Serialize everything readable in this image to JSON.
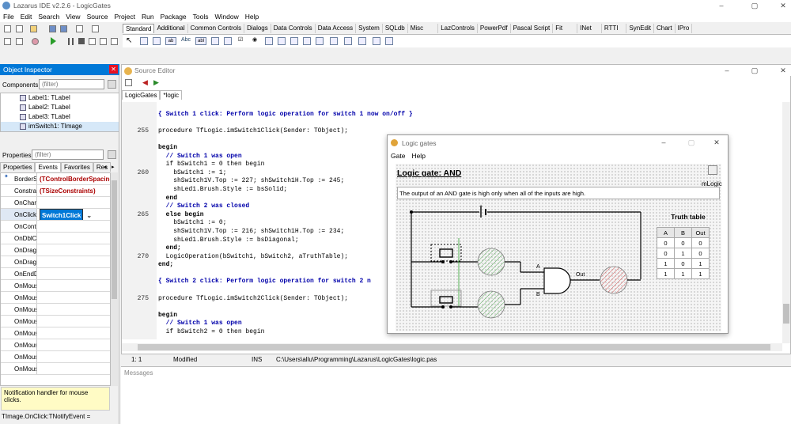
{
  "app": {
    "title": "Lazarus IDE v2.2.6 - LogicGates",
    "menu": [
      "File",
      "Edit",
      "Search",
      "View",
      "Source",
      "Project",
      "Run",
      "Package",
      "Tools",
      "Window",
      "Help"
    ],
    "window_buttons": [
      "–",
      "▢",
      "✕"
    ]
  },
  "palette": {
    "tabs": [
      "Standard",
      "Additional",
      "Common Controls",
      "Dialogs",
      "Data Controls",
      "Data Access",
      "System",
      "SQLdb",
      "Misc",
      "LazControls",
      "PowerPdf",
      "Pascal Script",
      "Fit",
      "INet",
      "RTTI",
      "SynEdit",
      "Chart",
      "IPro"
    ],
    "selected": "Standard",
    "glyphs": [
      "ab",
      "Abc",
      "abl",
      "⎘",
      "OK",
      "☑",
      "◉"
    ]
  },
  "object_inspector": {
    "title": "Object Inspector",
    "components_label": "Components",
    "filter_placeholder": "(filter)",
    "tree": [
      {
        "label": "Label1: TLabel",
        "selected": false
      },
      {
        "label": "Label2: TLabel",
        "selected": false
      },
      {
        "label": "Label3: TLabel",
        "selected": false
      },
      {
        "label": "imSwitch1: TImage",
        "selected": true
      }
    ],
    "properties_label": "Properties",
    "prop_filter_placeholder": "(filter)",
    "tabs": [
      "Properties",
      "Events",
      "Favorites",
      "Res"
    ],
    "selected_tab": "Events",
    "events": [
      {
        "name": "BorderSpacing",
        "value": "(TControlBorderSpacing)",
        "marker": "",
        "selected": false
      },
      {
        "name": "Constraints",
        "value": "(TSizeConstraints)",
        "marker": "",
        "selected": false
      },
      {
        "name": "OnChangeBounds",
        "value": "",
        "marker": "",
        "selected": false
      },
      {
        "name": "OnClick",
        "value": "Switch1Click",
        "marker": "✦",
        "selected": true
      },
      {
        "name": "OnContextPopup",
        "value": "",
        "marker": "",
        "selected": false
      },
      {
        "name": "OnDblClick",
        "value": "",
        "marker": "",
        "selected": false
      },
      {
        "name": "OnDragDrop",
        "value": "",
        "marker": "",
        "selected": false
      },
      {
        "name": "OnDragOver",
        "value": "",
        "marker": "",
        "selected": false
      },
      {
        "name": "OnEndDrag",
        "value": "",
        "marker": "",
        "selected": false
      },
      {
        "name": "OnMouseDown",
        "value": "",
        "marker": "",
        "selected": false
      },
      {
        "name": "OnMouseEnter",
        "value": "",
        "marker": "",
        "selected": false
      },
      {
        "name": "OnMouseLeave",
        "value": "",
        "marker": "",
        "selected": false
      },
      {
        "name": "OnMouseMove",
        "value": "",
        "marker": "",
        "selected": false
      },
      {
        "name": "OnMouseUp",
        "value": "",
        "marker": "",
        "selected": false
      },
      {
        "name": "OnMouseWheel",
        "value": "",
        "marker": "",
        "selected": false
      },
      {
        "name": "OnMouseWheelDown",
        "value": "",
        "marker": "",
        "selected": false
      },
      {
        "name": "OnMouseWheelUp",
        "value": "",
        "marker": "",
        "selected": false
      }
    ],
    "notification": "Notification handler for mouse clicks.",
    "status": "TImage.OnClick:TNotifyEvent ="
  },
  "source_editor": {
    "title": "Source Editor",
    "tabs": [
      "LogicGates",
      "*logic"
    ],
    "selected_tab": "*logic",
    "lines": [
      {
        "n": "",
        "t": "",
        "c": ""
      },
      {
        "n": "",
        "t": "{ Switch 1 click: Perform logic operation for switch 1 now on/off }",
        "c": "cm"
      },
      {
        "n": "",
        "t": "",
        "c": ""
      },
      {
        "n": "255",
        "t": "procedure TfLogic.imSwitch1Click(Sender: TObject);",
        "c": "kw1"
      },
      {
        "n": "",
        "t": "",
        "c": ""
      },
      {
        "n": "",
        "t": "begin",
        "c": "kw"
      },
      {
        "n": "",
        "t": "  // Switch 1 was open",
        "c": "cm"
      },
      {
        "n": "",
        "t": "  if bSwitch1 = 0 then begin",
        "c": "kw2"
      },
      {
        "n": "260",
        "t": "    bSwitch1 := 1;",
        "c": ""
      },
      {
        "n": "",
        "t": "    shSwitch1V.Top := 227; shSwitch1H.Top := 245;",
        "c": ""
      },
      {
        "n": "",
        "t": "    shLed1.Brush.Style := bsSolid;",
        "c": ""
      },
      {
        "n": "",
        "t": "  end",
        "c": "kw"
      },
      {
        "n": "",
        "t": "  // Switch 2 was closed",
        "c": "cm"
      },
      {
        "n": "265",
        "t": "  else begin",
        "c": "kw"
      },
      {
        "n": "",
        "t": "    bSwitch1 := 0;",
        "c": ""
      },
      {
        "n": "",
        "t": "    shSwitch1V.Top := 216; shSwitch1H.Top := 234;",
        "c": ""
      },
      {
        "n": "",
        "t": "    shLed1.Brush.Style := bsDiagonal;",
        "c": ""
      },
      {
        "n": "",
        "t": "  end;",
        "c": "kw"
      },
      {
        "n": "270",
        "t": "  LogicOperation(bSwitch1, bSwitch2, aTruthTable);",
        "c": ""
      },
      {
        "n": "",
        "t": "end;",
        "c": "kw"
      },
      {
        "n": "",
        "t": "",
        "c": ""
      },
      {
        "n": "",
        "t": "{ Switch 2 click: Perform logic operation for switch 2 n",
        "c": "cm"
      },
      {
        "n": "",
        "t": "",
        "c": ""
      },
      {
        "n": "275",
        "t": "procedure TfLogic.imSwitch2Click(Sender: TObject);",
        "c": "kw1"
      },
      {
        "n": "",
        "t": "",
        "c": ""
      },
      {
        "n": "",
        "t": "begin",
        "c": "kw"
      },
      {
        "n": "",
        "t": "  // Switch 1 was open",
        "c": "cm"
      },
      {
        "n": "",
        "t": "  if bSwitch2 = 0 then begin",
        "c": "kw2"
      }
    ],
    "status": {
      "pos": "1: 1",
      "state": "Modified",
      "mode": "INS",
      "file": "C:\\Users\\allu\\Programming\\Lazarus\\LogicGates\\logic.pas"
    },
    "messages_label": "Messages"
  },
  "logic_window": {
    "title": "Logic gates",
    "menu": [
      "Gate",
      "Help"
    ],
    "gate_title": "Logic gate: AND",
    "component_label": "mLogic",
    "description": "The output of an AND gate is high only when all of the inputs are high.",
    "input_labels": [
      "A",
      "B"
    ],
    "output_label": "Out",
    "battery_plus": "+",
    "truth_table": {
      "title": "Truth table",
      "headers": [
        "A",
        "B",
        "Out"
      ],
      "rows": [
        [
          "0",
          "0",
          "0"
        ],
        [
          "0",
          "1",
          "0"
        ],
        [
          "1",
          "0",
          "1"
        ],
        [
          "1",
          "1",
          "1"
        ]
      ]
    }
  }
}
